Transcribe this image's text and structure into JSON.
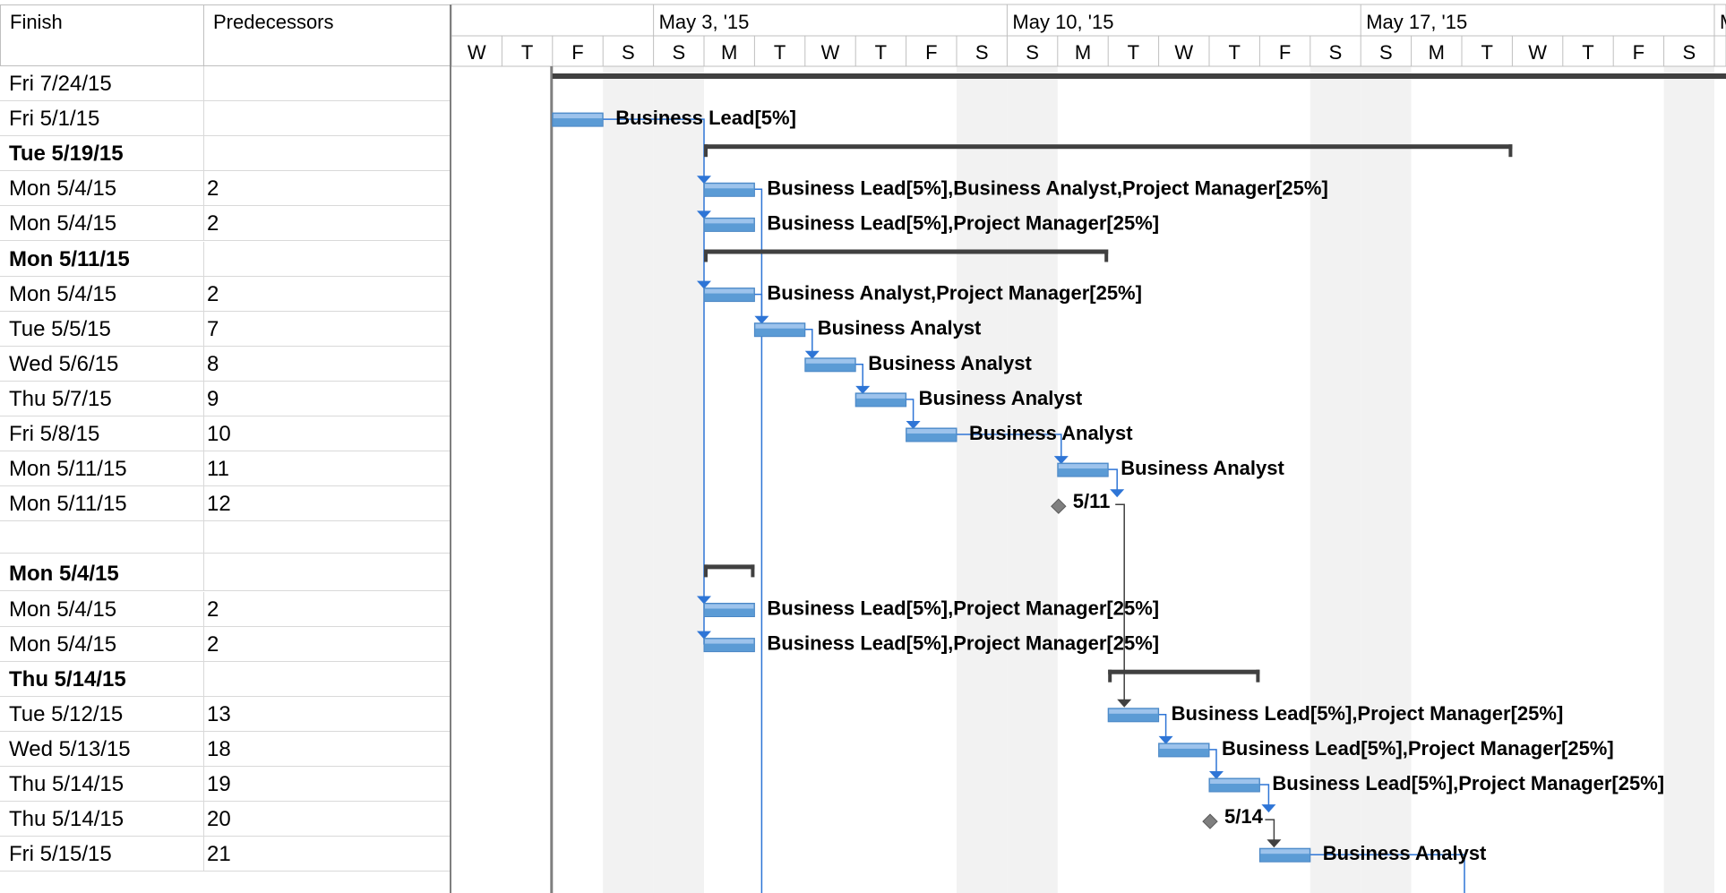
{
  "table": {
    "headers": {
      "finish": "Finish",
      "predecessors": "Predecessors"
    },
    "rows": [
      {
        "finish": "Fri 7/24/15",
        "pred": "",
        "summary": false
      },
      {
        "finish": "Fri 5/1/15",
        "pred": "",
        "summary": false
      },
      {
        "finish": "Tue 5/19/15",
        "pred": "",
        "summary": true
      },
      {
        "finish": "Mon 5/4/15",
        "pred": "2",
        "summary": false
      },
      {
        "finish": "Mon 5/4/15",
        "pred": "2",
        "summary": false
      },
      {
        "finish": "Mon 5/11/15",
        "pred": "",
        "summary": true
      },
      {
        "finish": "Mon 5/4/15",
        "pred": "2",
        "summary": false
      },
      {
        "finish": "Tue 5/5/15",
        "pred": "7",
        "summary": false
      },
      {
        "finish": "Wed 5/6/15",
        "pred": "8",
        "summary": false
      },
      {
        "finish": "Thu 5/7/15",
        "pred": "9",
        "summary": false
      },
      {
        "finish": "Fri 5/8/15",
        "pred": "10",
        "summary": false
      },
      {
        "finish": "Mon 5/11/15",
        "pred": "11",
        "summary": false
      },
      {
        "finish": "Mon 5/11/15",
        "pred": "12",
        "summary": false
      },
      {
        "finish": "",
        "pred": "",
        "summary": false
      },
      {
        "finish": "Mon 5/4/15",
        "pred": "",
        "summary": true
      },
      {
        "finish": "Mon 5/4/15",
        "pred": "2",
        "summary": false
      },
      {
        "finish": "Mon 5/4/15",
        "pred": "2",
        "summary": false
      },
      {
        "finish": "Thu 5/14/15",
        "pred": "",
        "summary": true
      },
      {
        "finish": "Tue 5/12/15",
        "pred": "13",
        "summary": false
      },
      {
        "finish": "Wed 5/13/15",
        "pred": "18",
        "summary": false
      },
      {
        "finish": "Thu 5/14/15",
        "pred": "19",
        "summary": false
      },
      {
        "finish": "Thu 5/14/15",
        "pred": "20",
        "summary": false
      },
      {
        "finish": "Fri 5/15/15",
        "pred": "21",
        "summary": false
      }
    ]
  },
  "timescale": {
    "weeks": [
      "May 3, '15",
      "May 10, '15",
      "May 17, '15",
      "M"
    ],
    "days": [
      "W",
      "T",
      "F",
      "S",
      "S",
      "M",
      "T",
      "W",
      "T",
      "F",
      "S",
      "S",
      "M",
      "T",
      "W",
      "T",
      "F",
      "S",
      "S",
      "M",
      "T",
      "W",
      "T",
      "F",
      "S"
    ]
  },
  "gantt": {
    "summaries": [
      {
        "row": 0,
        "start": "2015-05-01",
        "end": "2015-07-24"
      },
      {
        "row": 2,
        "start": "2015-05-04",
        "end": "2015-05-19"
      },
      {
        "row": 5,
        "start": "2015-05-04",
        "end": "2015-05-11"
      },
      {
        "row": 14,
        "start": "2015-05-04",
        "end": "2015-05-04"
      },
      {
        "row": 17,
        "start": "2015-05-12",
        "end": "2015-05-14"
      }
    ],
    "tasks": [
      {
        "row": 1,
        "start": "2015-05-01",
        "end": "2015-05-01",
        "label": "Business Lead[5%]"
      },
      {
        "row": 3,
        "start": "2015-05-04",
        "end": "2015-05-04",
        "label": "Business Lead[5%],Business Analyst,Project Manager[25%]"
      },
      {
        "row": 4,
        "start": "2015-05-04",
        "end": "2015-05-04",
        "label": "Business Lead[5%],Project Manager[25%]"
      },
      {
        "row": 6,
        "start": "2015-05-04",
        "end": "2015-05-04",
        "label": "Business Analyst,Project Manager[25%]"
      },
      {
        "row": 7,
        "start": "2015-05-05",
        "end": "2015-05-05",
        "label": "Business Analyst"
      },
      {
        "row": 8,
        "start": "2015-05-06",
        "end": "2015-05-06",
        "label": "Business Analyst"
      },
      {
        "row": 9,
        "start": "2015-05-07",
        "end": "2015-05-07",
        "label": "Business Analyst"
      },
      {
        "row": 10,
        "start": "2015-05-08",
        "end": "2015-05-08",
        "label": "Business Analyst"
      },
      {
        "row": 11,
        "start": "2015-05-11",
        "end": "2015-05-11",
        "label": "Business Analyst"
      },
      {
        "row": 15,
        "start": "2015-05-04",
        "end": "2015-05-04",
        "label": "Business Lead[5%],Project Manager[25%]"
      },
      {
        "row": 16,
        "start": "2015-05-04",
        "end": "2015-05-04",
        "label": "Business Lead[5%],Project Manager[25%]"
      },
      {
        "row": 18,
        "start": "2015-05-12",
        "end": "2015-05-12",
        "label": "Business Lead[5%],Project Manager[25%]"
      },
      {
        "row": 19,
        "start": "2015-05-13",
        "end": "2015-05-13",
        "label": "Business Lead[5%],Project Manager[25%]"
      },
      {
        "row": 20,
        "start": "2015-05-14",
        "end": "2015-05-14",
        "label": "Business Lead[5%],Project Manager[25%]"
      },
      {
        "row": 22,
        "start": "2015-05-15",
        "end": "2015-05-15",
        "label": "Business Analyst"
      }
    ],
    "milestones": [
      {
        "row": 12,
        "date": "2015-05-11",
        "label": "5/11"
      },
      {
        "row": 21,
        "date": "2015-05-14",
        "label": "5/14"
      }
    ],
    "colors": {
      "task": "#5b9bd5",
      "task_top": "#9dc3ec",
      "link": "#2e75d6",
      "summary": "#404040",
      "milestone": "#7f7f7f",
      "weekend": "#f2f2f2"
    }
  }
}
